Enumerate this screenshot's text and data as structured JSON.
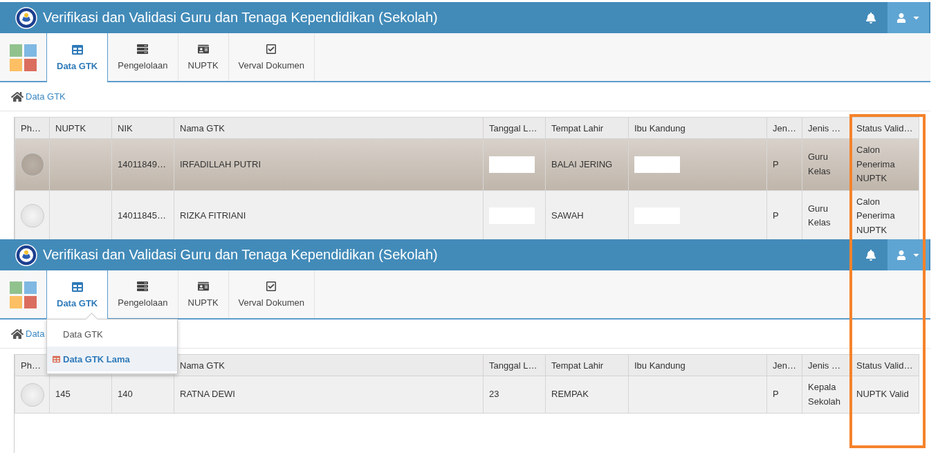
{
  "screens": [
    {
      "header": {
        "title": "Verifikasi dan Validasi Guru dan Tenaga Kependidikan (Sekolah)"
      },
      "tabs": [
        {
          "label": "Data GTK",
          "selected": true
        },
        {
          "label": "Pengelolaan",
          "selected": false
        },
        {
          "label": "NUPTK",
          "selected": false
        },
        {
          "label": "Verval Dokumen",
          "selected": false
        }
      ],
      "breadcrumb": {
        "text": "Data GTK"
      },
      "table": {
        "columns": [
          {
            "label": "Ph…"
          },
          {
            "label": "NUPTK"
          },
          {
            "label": "NIK"
          },
          {
            "label": "Nama GTK"
          },
          {
            "label": "Tanggal L…"
          },
          {
            "label": "Tempat Lahir"
          },
          {
            "label": "Ibu Kandung"
          },
          {
            "label": "Jen…"
          },
          {
            "label": "Jenis …"
          },
          {
            "label": "Status Valid…"
          }
        ],
        "rows": [
          {
            "selected": true,
            "cells": [
              {
                "kind": "avatar"
              },
              {
                "kind": "empty"
              },
              {
                "kind": "text",
                "text": "14011849…"
              },
              {
                "kind": "text",
                "text": "IRFADILLAH PUTRI"
              },
              {
                "kind": "redacted"
              },
              {
                "kind": "text",
                "text": "BALAI JERING"
              },
              {
                "kind": "redacted"
              },
              {
                "kind": "text",
                "text": "P"
              },
              {
                "kind": "text",
                "text": "Guru Kelas"
              },
              {
                "kind": "text",
                "text": "Calon Penerima NUPTK"
              }
            ]
          },
          {
            "selected": false,
            "cells": [
              {
                "kind": "avatar"
              },
              {
                "kind": "empty"
              },
              {
                "kind": "text",
                "text": "14011845…"
              },
              {
                "kind": "text",
                "text": "RIZKA FITRIANI"
              },
              {
                "kind": "redacted"
              },
              {
                "kind": "text",
                "text": "SAWAH"
              },
              {
                "kind": "redacted"
              },
              {
                "kind": "text",
                "text": "P"
              },
              {
                "kind": "text",
                "text": "Guru Kelas"
              },
              {
                "kind": "text",
                "text": "Calon Penerima NUPTK"
              }
            ]
          }
        ]
      }
    },
    {
      "header": {
        "title": "Verifikasi dan Validasi Guru dan Tenaga Kependidikan (Sekolah)"
      },
      "tabs": [
        {
          "label": "Data GTK",
          "selected": true
        },
        {
          "label": "Pengelolaan",
          "selected": false
        },
        {
          "label": "NUPTK",
          "selected": false
        },
        {
          "label": "Verval Dokumen",
          "selected": false
        }
      ],
      "breadcrumb": {
        "text": "Data"
      },
      "dropdown": {
        "items": [
          {
            "label": "Data GTK",
            "selected": false
          },
          {
            "label": "Data GTK Lama",
            "selected": true
          }
        ]
      },
      "table": {
        "columns": [
          {
            "label": "Ph…"
          },
          {},
          {},
          {
            "label": "Nama GTK"
          },
          {
            "label": "Tanggal L…"
          },
          {
            "label": "Tempat Lahir"
          },
          {
            "label": "Ibu Kandung"
          },
          {
            "label": "Jen…"
          },
          {
            "label": "Jenis …"
          },
          {
            "label": "Status Valid…"
          }
        ],
        "rows": [
          {
            "selected": false,
            "cells": [
              {
                "kind": "avatar"
              },
              {
                "kind": "text",
                "text": "145"
              },
              {
                "kind": "text",
                "text": "140"
              },
              {
                "kind": "text",
                "text": "RATNA DEWI"
              },
              {
                "kind": "text",
                "text": "23"
              },
              {
                "kind": "text",
                "text": "REMPAK"
              },
              {
                "kind": "empty"
              },
              {
                "kind": "text",
                "text": "P"
              },
              {
                "kind": "text",
                "text": "Kepala Sekolah"
              },
              {
                "kind": "text",
                "text": "NUPTK Valid"
              }
            ]
          }
        ]
      }
    }
  ]
}
